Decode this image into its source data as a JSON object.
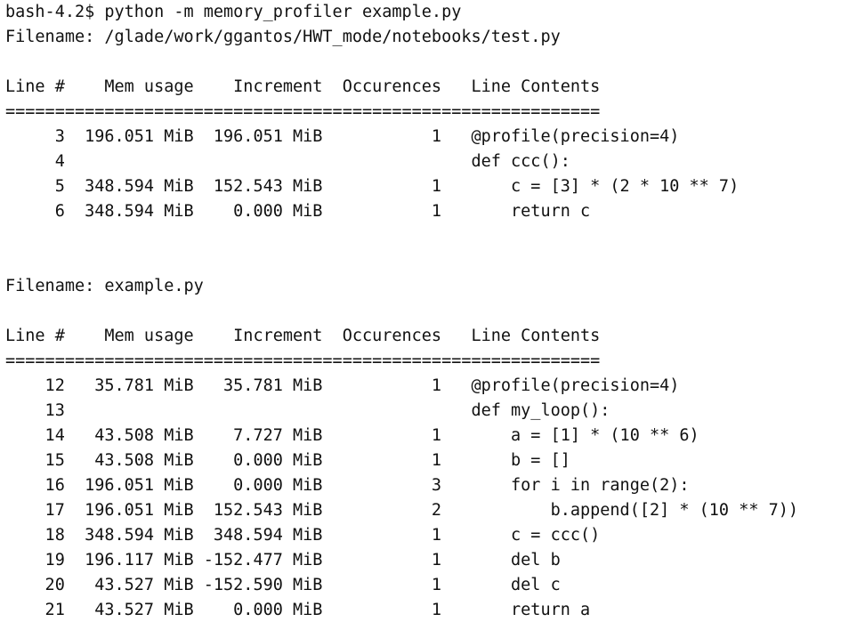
{
  "terminal": {
    "lines": [
      "bash-4.2$ python -m memory_profiler example.py",
      "Filename: /glade/work/ggantos/HWT_mode/notebooks/test.py",
      "",
      "Line #    Mem usage    Increment  Occurences   Line Contents",
      "============================================================",
      "     3  196.051 MiB  196.051 MiB           1   @profile(precision=4)",
      "     4                                         def ccc():",
      "     5  348.594 MiB  152.543 MiB           1       c = [3] * (2 * 10 ** 7)",
      "     6  348.594 MiB    0.000 MiB           1       return c",
      "",
      "",
      "Filename: example.py",
      "",
      "Line #    Mem usage    Increment  Occurences   Line Contents",
      "============================================================",
      "    12   35.781 MiB   35.781 MiB           1   @profile(precision=4)",
      "    13                                         def my_loop():",
      "    14   43.508 MiB    7.727 MiB           1       a = [1] * (10 ** 6)",
      "    15   43.508 MiB    0.000 MiB           1       b = []",
      "    16  196.051 MiB    0.000 MiB           3       for i in range(2):",
      "    17  196.051 MiB  152.543 MiB           2           b.append([2] * (10 ** 7))",
      "    18  348.594 MiB  348.594 MiB           1       c = ccc()",
      "    19  196.117 MiB -152.477 MiB           1       del b",
      "    20   43.527 MiB -152.590 MiB           1       del c",
      "    21   43.527 MiB    0.000 MiB           1       return a"
    ]
  }
}
